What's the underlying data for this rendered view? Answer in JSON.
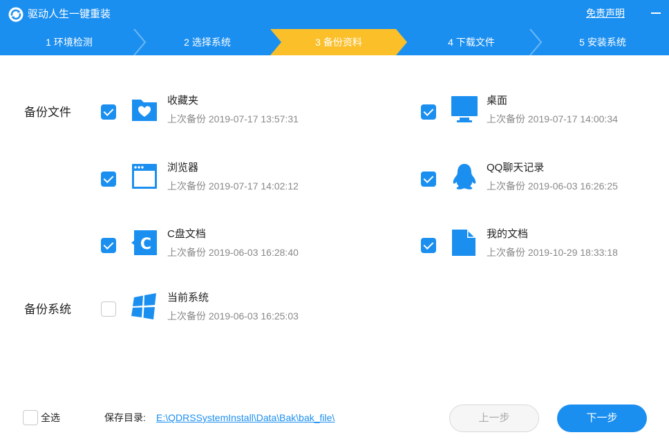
{
  "app": {
    "title": "驱动人生一键重装",
    "disclaimer": "免责声明"
  },
  "colors": {
    "brand_blue": "#1b8ff0",
    "active_step": "#fbbf2a",
    "muted_text": "#888888"
  },
  "steps": [
    {
      "label": "1 环境检测",
      "active": false
    },
    {
      "label": "2 选择系统",
      "active": false
    },
    {
      "label": "3 备份资料",
      "active": true
    },
    {
      "label": "4 下载文件",
      "active": false
    },
    {
      "label": "5 安装系统",
      "active": false
    }
  ],
  "backup_files": {
    "label": "备份文件",
    "items": [
      {
        "name": "收藏夹",
        "last_backup": "上次备份 2019-07-17 13:57:31",
        "checked": true,
        "icon": "favorites-folder-icon"
      },
      {
        "name": "桌面",
        "last_backup": "上次备份 2019-07-17 14:00:34",
        "checked": true,
        "icon": "desktop-monitor-icon"
      },
      {
        "name": "浏览器",
        "last_backup": "上次备份 2019-07-17 14:02:12",
        "checked": true,
        "icon": "browser-window-icon"
      },
      {
        "name": "QQ聊天记录",
        "last_backup": "上次备份 2019-06-03 16:26:25",
        "checked": true,
        "icon": "qq-penguin-icon"
      },
      {
        "name": "C盘文档",
        "last_backup": "上次备份 2019-06-03 16:28:40",
        "checked": true,
        "icon": "c-drive-document-icon"
      },
      {
        "name": "我的文档",
        "last_backup": "上次备份 2019-10-29 18:33:18",
        "checked": true,
        "icon": "my-document-icon"
      }
    ]
  },
  "backup_system": {
    "label": "备份系统",
    "items": [
      {
        "name": "当前系统",
        "last_backup": "上次备份 2019-06-03 16:25:03",
        "checked": false,
        "icon": "windows-logo-icon"
      }
    ]
  },
  "footer": {
    "select_all": "全选",
    "select_all_checked": false,
    "save_dir_label": "保存目录:",
    "save_dir_path": "E:\\QDRSSystemInstall\\Data\\Bak\\bak_file\\",
    "prev_button": "上一步",
    "next_button": "下一步"
  }
}
